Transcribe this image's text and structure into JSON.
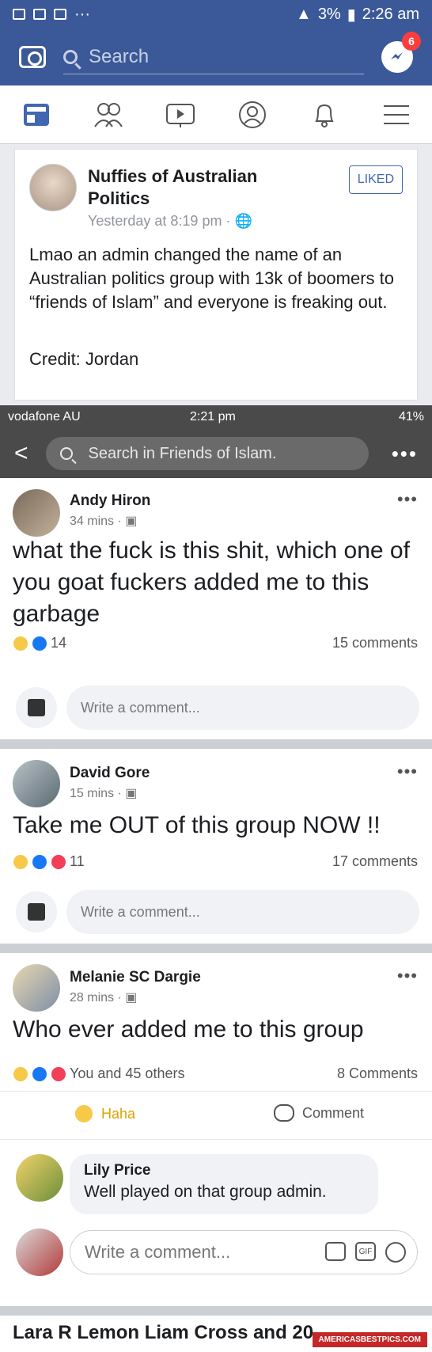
{
  "outer_status": {
    "left_icons": [
      "image-icon",
      "battery-saver-icon",
      "facebook-icon"
    ],
    "more": "···",
    "right": "3%",
    "time": "2:26 am"
  },
  "fb_header": {
    "search_placeholder": "Search",
    "messenger_badge": "6"
  },
  "nav": [
    "news-feed-icon",
    "friends-icon",
    "watch-icon",
    "profile-icon",
    "notifications-icon",
    "menu-icon"
  ],
  "outer_post": {
    "page_name": "Nuffies of Australian Politics",
    "liked_label": "LIKED",
    "time": "Yesterday at 8:19 pm · 🌐",
    "text": "Lmao an admin changed the name of an Australian politics group with 13k of boomers to “friends of Islam” and everyone is freaking out.",
    "credit": "Credit: Jordan"
  },
  "inner_status": {
    "carrier": "vodafone AU",
    "time": "2:21 pm",
    "battery": "41%"
  },
  "inner_search": {
    "back": "<",
    "placeholder": "Search in Friends of Islam.",
    "more": "•••"
  },
  "posts": [
    {
      "name": "Andy Hiron",
      "time": "34 mins · ▣",
      "text": "what the fuck is this shit, which one of you goat fuckers added me to this garbage",
      "reactions": "14",
      "comments": "15 comments",
      "write": "Write a comment..."
    },
    {
      "name": "David Gore",
      "time": "15 mins · ▣",
      "text": "Take me OUT of this group NOW !!",
      "reactions": "11",
      "comments": "17 comments",
      "write": "Write a comment..."
    },
    {
      "name": "Melanie SC Dargie",
      "time": "28 mins · ▣",
      "text": "Who ever added me to this group",
      "reactions": "You and 45 others",
      "comments": "8 Comments",
      "haha": "Haha",
      "comment": "Comment",
      "reply_name": "Lily Price",
      "reply_text": "Well played on that group admin.",
      "write": "Write a comment..."
    }
  ],
  "cutoff_text": "Lara R  Lemon  Liam Cross and 20",
  "watermark": "AMERICASBESTPICS.COM",
  "colors": {
    "fb_blue": "#3b5998",
    "link_blue": "#4267b2",
    "inner_bar": "#4a4a4a"
  }
}
